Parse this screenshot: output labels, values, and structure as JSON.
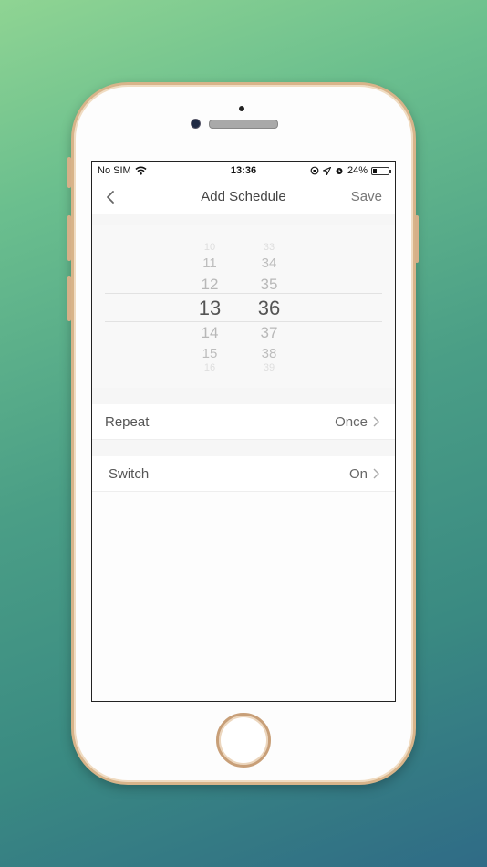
{
  "status_bar": {
    "carrier": "No SIM",
    "time": "13:36",
    "battery": "24%",
    "battery_level": 0.24
  },
  "nav": {
    "title": "Add Schedule",
    "save_label": "Save",
    "back_icon": "chevron-left-icon"
  },
  "picker": {
    "hours": [
      "10",
      "11",
      "12",
      "13",
      "14",
      "15",
      "16"
    ],
    "minutes": [
      "33",
      "34",
      "35",
      "36",
      "37",
      "38",
      "39"
    ],
    "selected_hour": "13",
    "selected_minute": "36"
  },
  "settings": [
    {
      "label": "Repeat",
      "value": "Once"
    },
    {
      "label": "Switch",
      "value": "On"
    }
  ],
  "colors": {
    "frame_gold": "#d8b48a",
    "text_gray": "#555555"
  }
}
